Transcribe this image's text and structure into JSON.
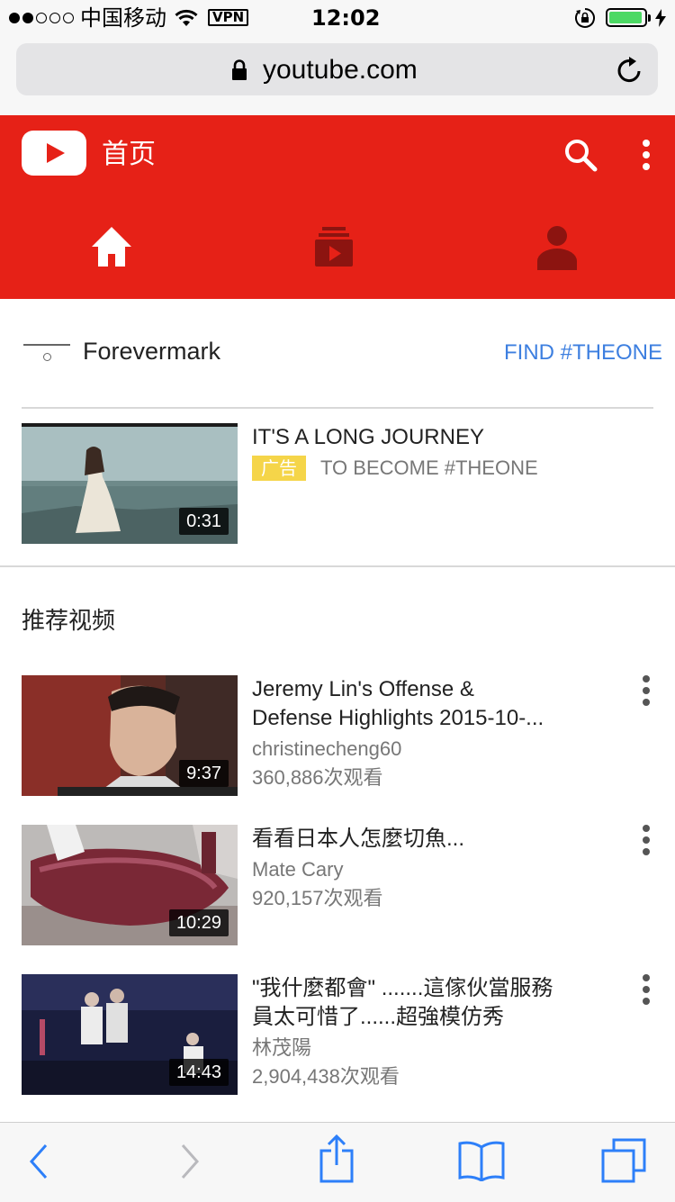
{
  "status_bar": {
    "carrier": "中国移动",
    "vpn": "VPN",
    "time": "12:02",
    "battery_level": 0.95
  },
  "browser": {
    "url": "youtube.com",
    "icons": [
      "lock-icon",
      "reload-icon"
    ]
  },
  "header": {
    "title": "首页",
    "brand_color": "#e62117",
    "tabs": [
      {
        "name": "home",
        "icon": "home-icon",
        "active": true
      },
      {
        "name": "subscriptions",
        "icon": "subscriptions-icon",
        "active": false
      },
      {
        "name": "account",
        "icon": "account-icon",
        "active": false
      }
    ]
  },
  "ad": {
    "advertiser": "Forevermark",
    "cta": "FIND #THEONE",
    "title": "IT'S A LONG JOURNEY",
    "badge": "广告",
    "subtitle": "TO BECOME #THEONE",
    "duration": "0:31"
  },
  "recommended": {
    "section_title": "推荐视频",
    "videos": [
      {
        "title_line1": "Jeremy Lin's Offense &",
        "title_line2": "Defense Highlights 2015-10-...",
        "channel": "christinecheng60",
        "views": "360,886次观看",
        "duration": "9:37"
      },
      {
        "title_line1": "看看日本人怎麼切魚...",
        "title_line2": "",
        "channel": "Mate Cary",
        "views": "920,157次观看",
        "duration": "10:29"
      },
      {
        "title_line1": "\"我什麼都會\" .......這傢伙當服務",
        "title_line2": "員太可惜了......超強模仿秀",
        "channel": "林茂陽",
        "views": "2,904,438次观看",
        "duration": "14:43"
      }
    ]
  },
  "toolbar": {
    "icons": [
      "back-icon",
      "forward-icon",
      "share-icon",
      "bookmarks-icon",
      "tabs-icon"
    ],
    "accent": "#2d7ff9"
  }
}
